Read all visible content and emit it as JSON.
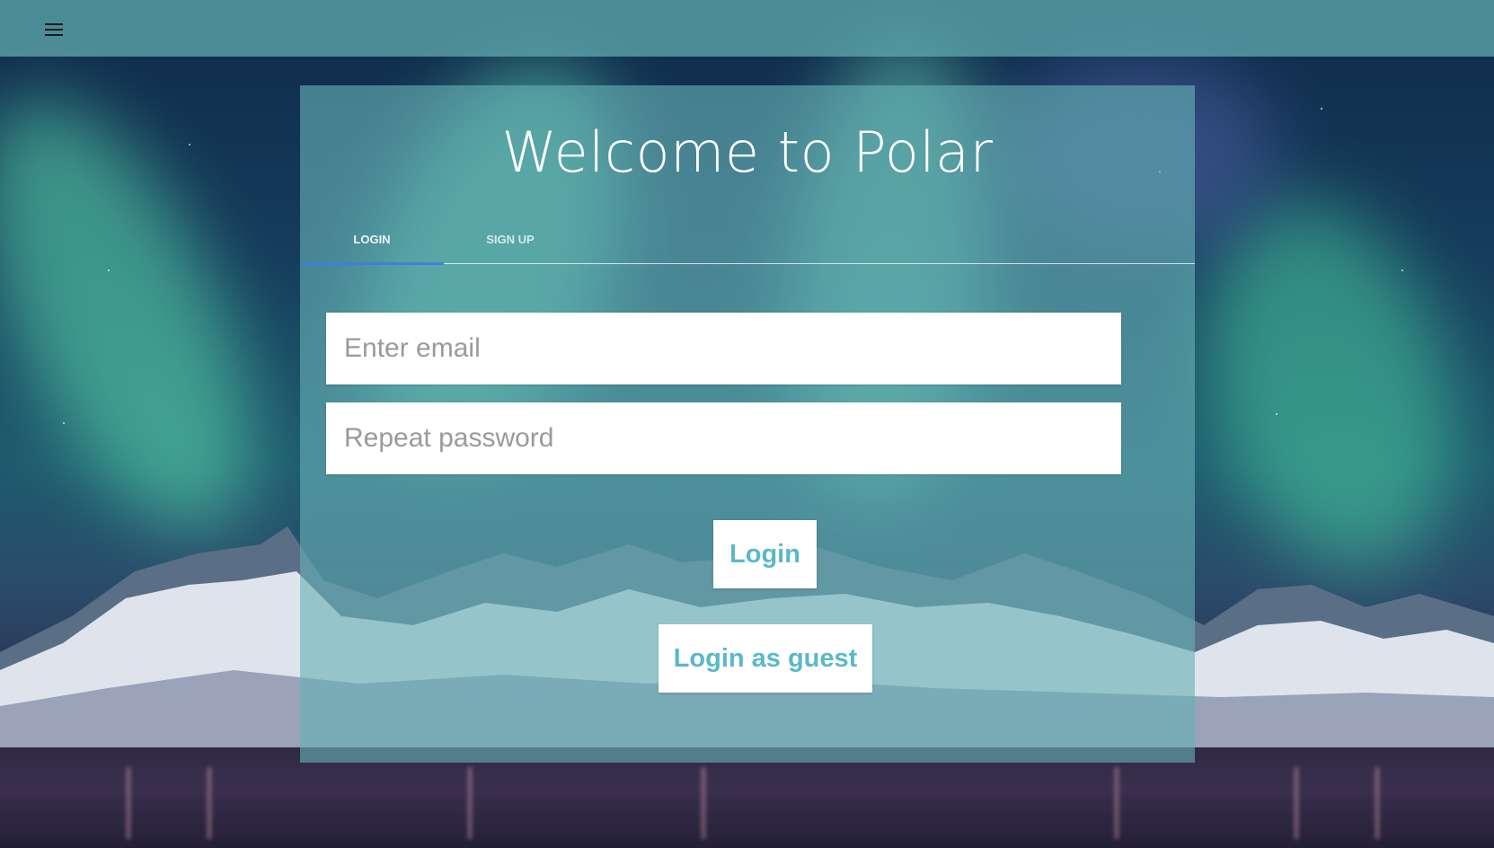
{
  "header": {
    "menu_icon": "menu-icon"
  },
  "card": {
    "title": "Welcome to Polar",
    "tabs": [
      {
        "label": "LOGIN",
        "active": true
      },
      {
        "label": "SIGN UP",
        "active": false
      }
    ],
    "email_field": {
      "value": "",
      "placeholder": "Enter email"
    },
    "password_field": {
      "value": "",
      "placeholder": "Repeat password"
    },
    "login_button": "Login",
    "guest_button": "Login as guest"
  },
  "colors": {
    "accent": "#5bb8c8",
    "tab_indicator": "#3f7fdc",
    "topbar": "#5ca7ac"
  }
}
